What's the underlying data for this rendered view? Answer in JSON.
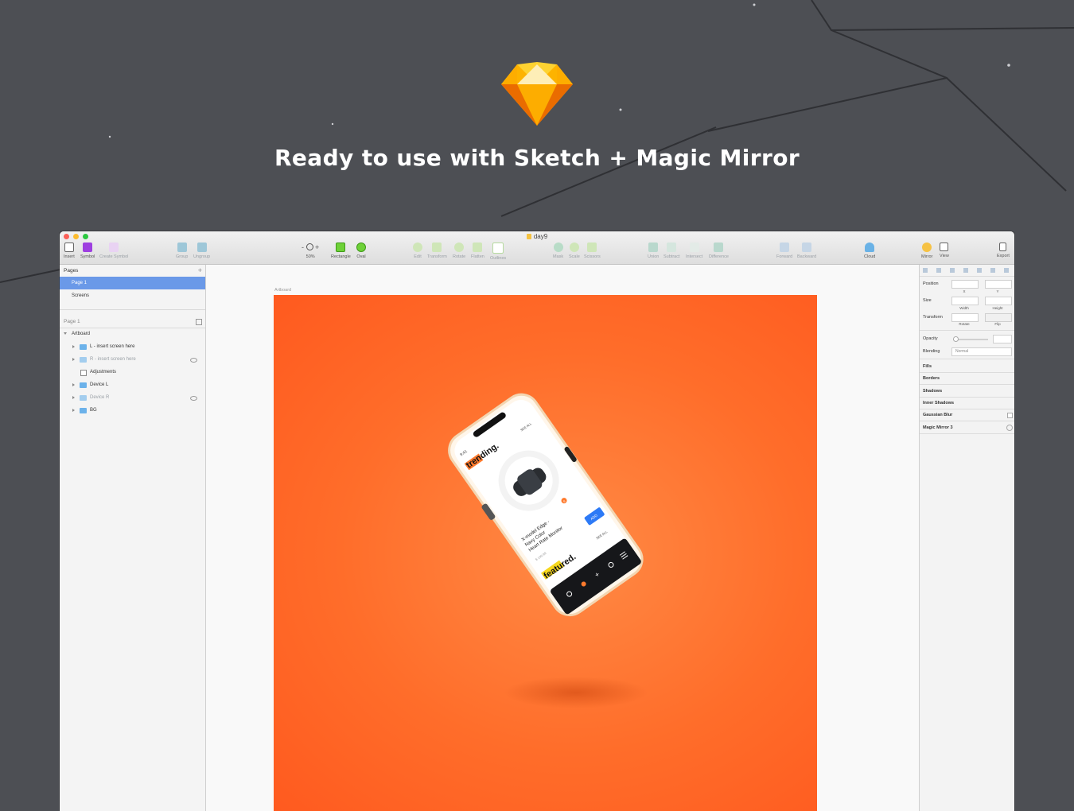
{
  "hero": {
    "title": "Ready to use with Sketch + Magic Mirror"
  },
  "window": {
    "doc_title": "day9"
  },
  "toolbar": {
    "items": [
      {
        "label": "Insert"
      },
      {
        "label": "Symbol"
      },
      {
        "label": "Create Symbol"
      },
      {
        "label": "Group"
      },
      {
        "label": "Ungroup"
      },
      {
        "label": "50%"
      },
      {
        "label": "Rectangle"
      },
      {
        "label": "Oval"
      },
      {
        "label": "Edit"
      },
      {
        "label": "Transform"
      },
      {
        "label": "Rotate"
      },
      {
        "label": "Flatten"
      },
      {
        "label": "Outlines"
      },
      {
        "label": "Mask"
      },
      {
        "label": "Scale"
      },
      {
        "label": "Scissors"
      },
      {
        "label": "Union"
      },
      {
        "label": "Subtract"
      },
      {
        "label": "Intersect"
      },
      {
        "label": "Difference"
      },
      {
        "label": "Forward"
      },
      {
        "label": "Backward"
      },
      {
        "label": "Cloud"
      },
      {
        "label": "Mirror"
      },
      {
        "label": "View"
      },
      {
        "label": "Export"
      }
    ],
    "zoom_minus": "-",
    "zoom_plus": "+"
  },
  "pages_panel": {
    "header": "Pages",
    "add": "+",
    "pages": [
      "Page 1",
      "Screens"
    ]
  },
  "layers_panel": {
    "header": "Page 1",
    "artboard": "Artboard",
    "layers": [
      {
        "name": "L - insert screen here"
      },
      {
        "name": "R - insert screen here"
      },
      {
        "name": "Adjustments"
      },
      {
        "name": "Device L"
      },
      {
        "name": "Device R"
      },
      {
        "name": "BG"
      }
    ]
  },
  "canvas": {
    "artboard_label": "Artboard",
    "phone": {
      "section_top": "trending.",
      "section_bottom": "featured.",
      "see_all": "SEE ALL",
      "time": "9:41",
      "product_line1": "X-model Edge -",
      "product_line2": "Navy Color",
      "product_line3": "Heart Rate Monitor",
      "price": "$ 149.99",
      "add_button": "ADD",
      "badge": "8"
    }
  },
  "inspector": {
    "position": "Position",
    "x": "X",
    "y": "Y",
    "size": "Size",
    "width": "Width",
    "height": "Height",
    "transform": "Transform",
    "rotate": "Rotate",
    "flip": "Flip",
    "opacity": "Opacity",
    "blending": "Blending",
    "blending_value": "Normal",
    "fills": "Fills",
    "borders": "Borders",
    "shadows": "Shadows",
    "inner_shadows": "Inner Shadows",
    "gaussian_blur": "Gaussian Blur",
    "magic_mirror": "Magic Mirror 3"
  },
  "colors": {
    "background": "#4d4f54",
    "artboard": "#ff6d2a",
    "selection": "#6a99e8"
  }
}
